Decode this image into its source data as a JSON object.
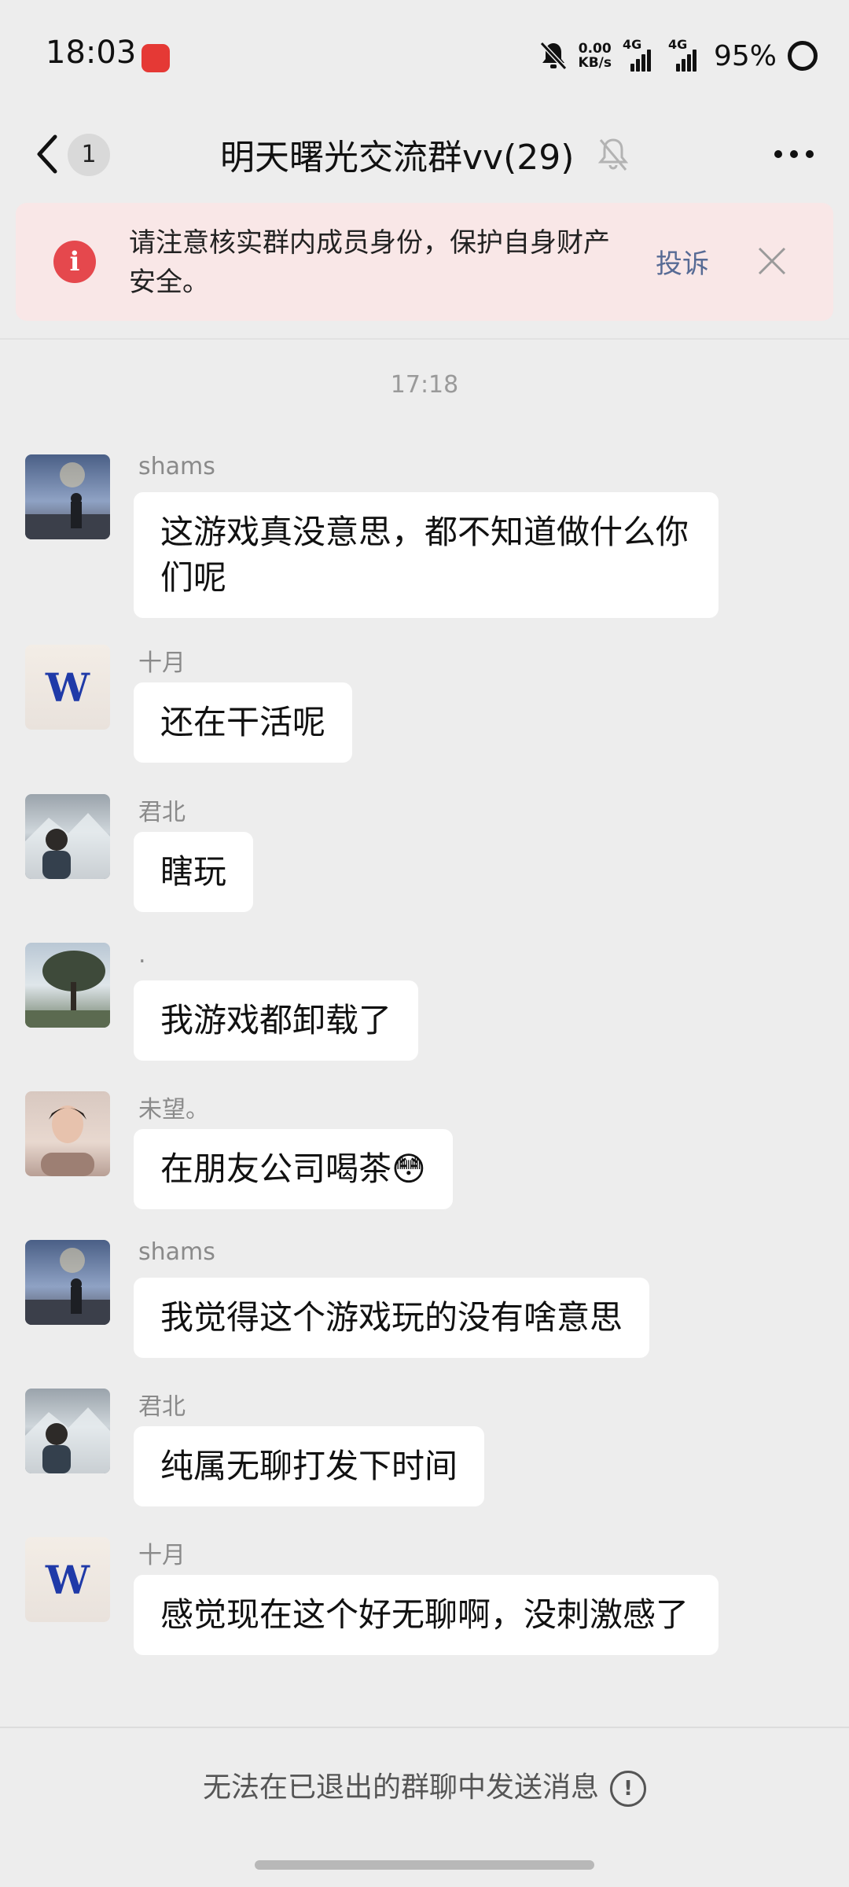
{
  "status_bar": {
    "time": "18:03",
    "net_speed_value": "0.00",
    "net_speed_unit": "KB/s",
    "sim1_tag": "4G",
    "sim2_tag": "4G",
    "battery": "95%"
  },
  "header": {
    "unread_count": "1",
    "title": "明天曙光交流群vv(29)"
  },
  "banner": {
    "icon_glyph": "i",
    "text": "请注意核实群内成员身份，保护自身财产安全。",
    "report_label": "投诉"
  },
  "timestamp": "17:18",
  "messages": [
    {
      "sender": "shams",
      "text": "这游戏真没意思，都不知道做什么你们呢",
      "avatar": "landscape-silhouette-avatar"
    },
    {
      "sender": "十月",
      "text": "还在干活呢",
      "avatar": "letter-w-avatar"
    },
    {
      "sender": "君北",
      "text": "瞎玩",
      "avatar": "mountain-portrait-avatar"
    },
    {
      "sender": ".",
      "text": "我游戏都卸载了",
      "avatar": "tree-avatar"
    },
    {
      "sender": "未望。",
      "text": "在朋友公司喝茶😳",
      "avatar": "portrait-avatar"
    },
    {
      "sender": "shams",
      "text": "我觉得这个游戏玩的没有啥意思",
      "avatar": "landscape-silhouette-avatar"
    },
    {
      "sender": "君北",
      "text": "纯属无聊打发下时间",
      "avatar": "mountain-portrait-avatar"
    },
    {
      "sender": "十月",
      "text": "感觉现在这个好无聊啊，没刺激感了",
      "avatar": "letter-w-avatar"
    }
  ],
  "avatar_letter": "W",
  "bottom": {
    "notice": "无法在已退出的群聊中发送消息",
    "notice_icon_glyph": "!"
  }
}
